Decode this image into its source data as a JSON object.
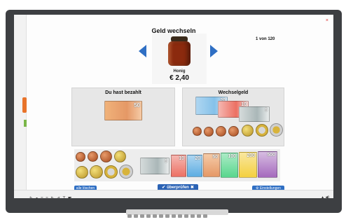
{
  "app": {
    "title": "Geld wechseln",
    "counter": "1 von 120",
    "close_icon": "close-icon"
  },
  "product": {
    "name": "Honig",
    "price": "€ 2,40",
    "icon": "honey-jar-image"
  },
  "nav": {
    "prev_icon": "arrow-left-icon",
    "next_icon": "arrow-right-icon"
  },
  "panels": {
    "paid": {
      "title": "Du hast bezahlt"
    },
    "change": {
      "title": "Wechselgeld"
    }
  },
  "tray": {
    "notes": [
      "5",
      "10",
      "20",
      "50",
      "100",
      "200",
      "500"
    ]
  },
  "buttons": {
    "clear": "alle löschen",
    "check": "überprüfen",
    "settings": "Einstellungen"
  },
  "colors": {
    "accent": "#2f6fc4",
    "panel": "#e7e7e7",
    "tab": "#e8732a"
  }
}
